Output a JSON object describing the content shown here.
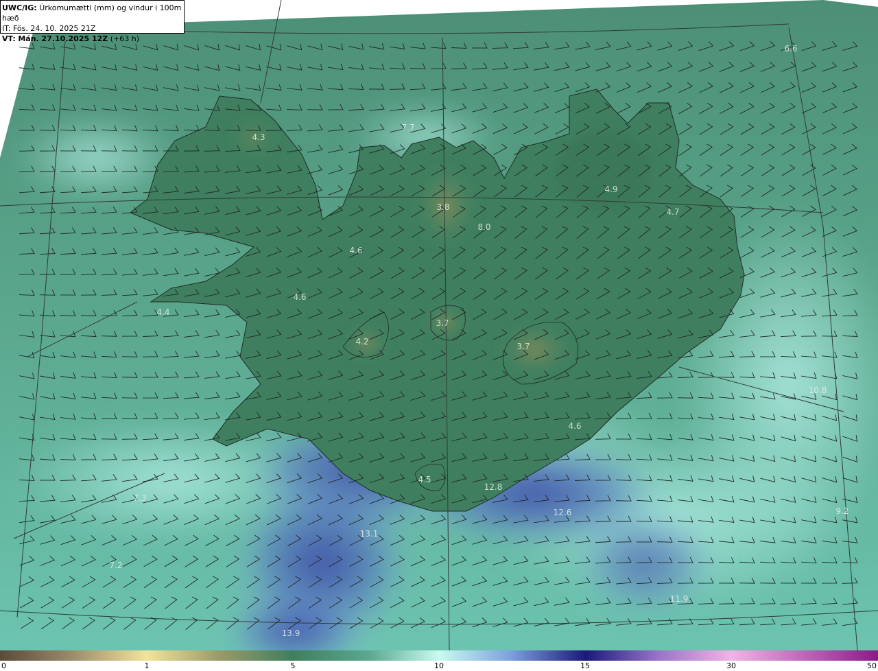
{
  "header": {
    "model_label": "UWC/IG:",
    "product": "Úrkomumætti (mm) og vindur i 100m hæð",
    "issue_label": "IT:",
    "issue_time": "Fös. 24. 10. 2025 21Z",
    "valid_label": "VT:",
    "valid_time": "Mán. 27.10.2025 12Z",
    "lead_time": "(+63 h)"
  },
  "colorbar": {
    "ticks": [
      "0",
      "1",
      "5",
      "10",
      "15",
      "30",
      "50"
    ]
  },
  "value_labels": [
    {
      "text": "4.3"
    },
    {
      "text": "7.7"
    },
    {
      "text": "3.8"
    },
    {
      "text": "8.0"
    },
    {
      "text": "4.9"
    },
    {
      "text": "4.7"
    },
    {
      "text": "6.6"
    },
    {
      "text": "4.6"
    },
    {
      "text": "4.6"
    },
    {
      "text": "4.4"
    },
    {
      "text": "4.2"
    },
    {
      "text": "3.7"
    },
    {
      "text": "3.7"
    },
    {
      "text": "4.6"
    },
    {
      "text": "4.5"
    },
    {
      "text": "12.8"
    },
    {
      "text": "12.6"
    },
    {
      "text": "13.1"
    },
    {
      "text": "7.3"
    },
    {
      "text": "7.2"
    },
    {
      "text": "13.9"
    },
    {
      "text": "11.9"
    },
    {
      "text": "10.8"
    },
    {
      "text": "9.2"
    }
  ],
  "colors": {
    "sea_base": "#4f9a82",
    "land_base": "#3f7f5e",
    "high_precip": "#3c4ea8",
    "light_precip": "#9fe6dc"
  }
}
